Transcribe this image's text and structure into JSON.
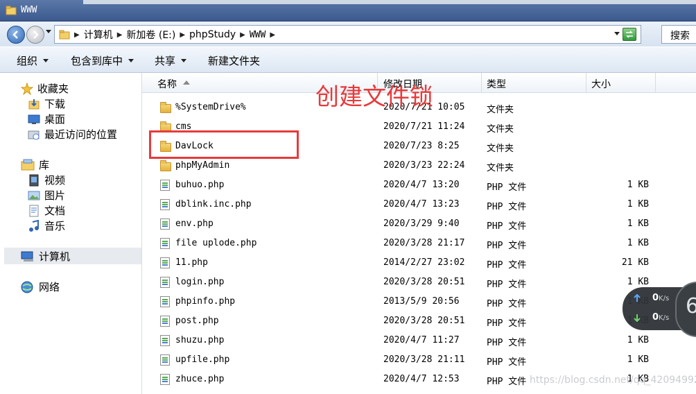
{
  "window": {
    "title": "WWW"
  },
  "address": {
    "crumbs": [
      "计算机",
      "新加卷 (E:)",
      "phpStudy",
      "WWW"
    ]
  },
  "search": {
    "placeholder": "搜索"
  },
  "toolbar": {
    "organize": "组织",
    "include_library": "包含到库中",
    "share": "共享",
    "new_folder": "新建文件夹"
  },
  "nav": {
    "favorites": "收藏夹",
    "downloads": "下载",
    "desktop": "桌面",
    "recent": "最近访问的位置",
    "libraries": "库",
    "videos": "视频",
    "pictures": "图片",
    "documents": "文档",
    "music": "音乐",
    "computer": "计算机",
    "network": "网络"
  },
  "columns": {
    "name": "名称",
    "modified": "修改日期",
    "type": "类型",
    "size": "大小"
  },
  "files": [
    {
      "name": "%SystemDrive%",
      "modified": "2020/7/21 10:05",
      "type": "文件夹",
      "size": "",
      "icon": "folder-icon"
    },
    {
      "name": "cms",
      "modified": "2020/7/21 11:24",
      "type": "文件夹",
      "size": "",
      "icon": "folder-icon"
    },
    {
      "name": "DavLock",
      "modified": "2020/7/23 8:25",
      "type": "文件夹",
      "size": "",
      "icon": "folder-icon"
    },
    {
      "name": "phpMyAdmin",
      "modified": "2020/3/23 22:24",
      "type": "文件夹",
      "size": "",
      "icon": "folder-icon"
    },
    {
      "name": "buhuo.php",
      "modified": "2020/4/7 13:20",
      "type": "PHP 文件",
      "size": "1 KB",
      "icon": "php-file-icon"
    },
    {
      "name": "dblink.inc.php",
      "modified": "2020/4/7 13:23",
      "type": "PHP 文件",
      "size": "1 KB",
      "icon": "php-file-icon"
    },
    {
      "name": "env.php",
      "modified": "2020/3/29 9:40",
      "type": "PHP 文件",
      "size": "1 KB",
      "icon": "php-file-icon"
    },
    {
      "name": "file uplode.php",
      "modified": "2020/3/28 21:17",
      "type": "PHP 文件",
      "size": "1 KB",
      "icon": "php-file-icon"
    },
    {
      "name": "11.php",
      "modified": "2014/2/27 23:02",
      "type": "PHP 文件",
      "size": "21 KB",
      "icon": "php-file-icon"
    },
    {
      "name": "login.php",
      "modified": "2020/3/28 20:51",
      "type": "PHP 文件",
      "size": "1 KB",
      "icon": "php-file-icon"
    },
    {
      "name": "phpinfo.php",
      "modified": "2013/5/9 20:56",
      "type": "PHP 文件",
      "size": "1 KB",
      "icon": "php-file-icon"
    },
    {
      "name": "post.php",
      "modified": "2020/3/28 20:51",
      "type": "PHP 文件",
      "size": "1 KB",
      "icon": "php-file-icon"
    },
    {
      "name": "shuzu.php",
      "modified": "2020/4/7 11:27",
      "type": "PHP 文件",
      "size": "1 KB",
      "icon": "php-file-icon"
    },
    {
      "name": "upfile.php",
      "modified": "2020/3/28 21:11",
      "type": "PHP 文件",
      "size": "1 KB",
      "icon": "php-file-icon"
    },
    {
      "name": "zhuce.php",
      "modified": "2020/4/7 12:53",
      "type": "PHP 文件",
      "size": "1 KB",
      "icon": "php-file-icon"
    }
  ],
  "annotation": {
    "text": "创建文件锁",
    "color": "#e83a3a"
  },
  "speed_widget": {
    "up": "0",
    "down": "0",
    "unit": "K/s",
    "number": "6"
  },
  "watermark": "https://blog.csdn.net/qq_42094992"
}
